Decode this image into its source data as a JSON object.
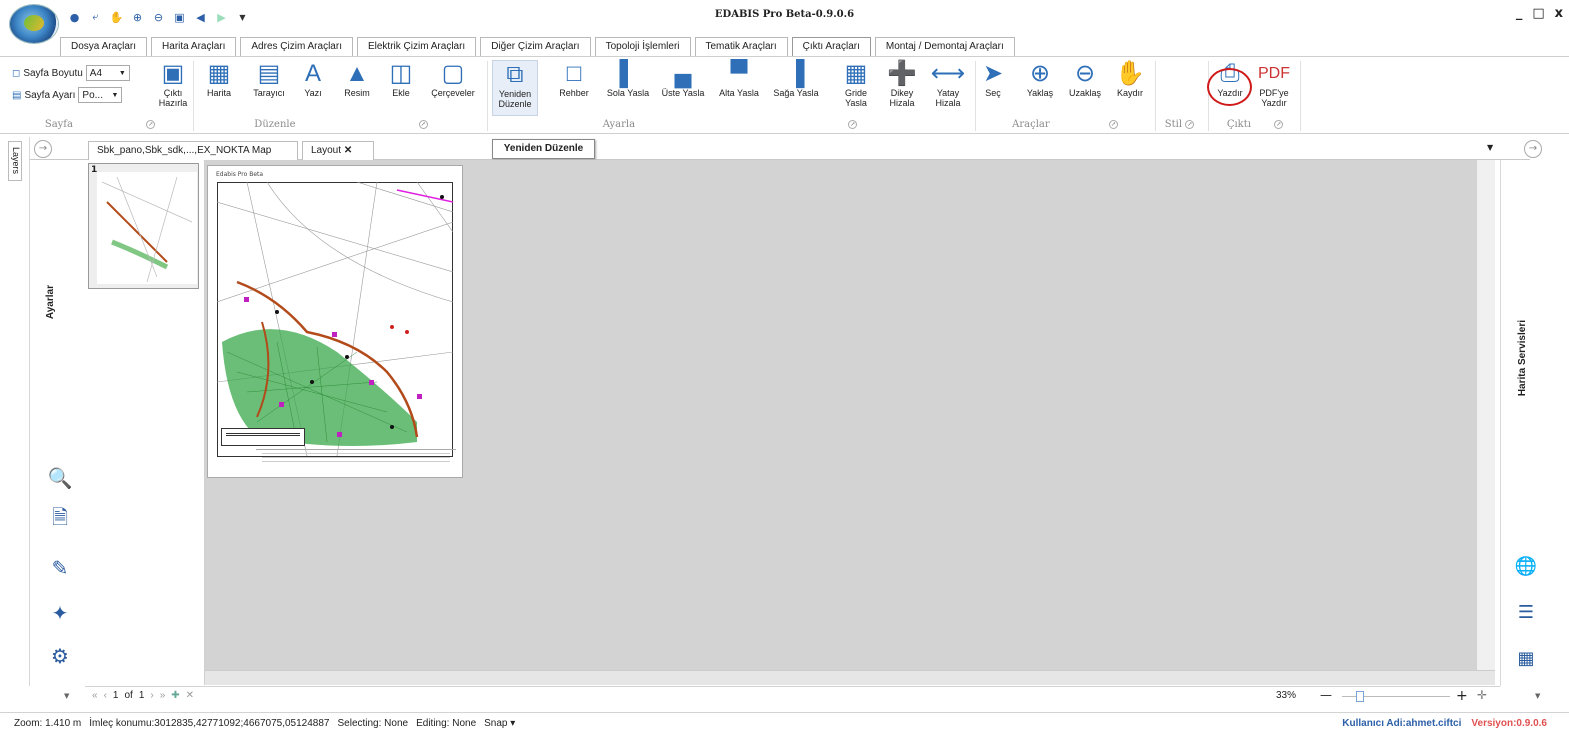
{
  "app": {
    "title": "EDABIS Pro Beta-0.9.0.6",
    "window_controls": [
      "_",
      "□",
      "x"
    ]
  },
  "tabs": [
    "Dosya Araçları",
    "Harita Araçları",
    "Adres Çizim Araçları",
    "Elektrik Çizim Araçları",
    "Diğer Çizim Araçları",
    "Topoloji İşlemleri",
    "Tematik Araçları",
    "Çıktı Araçları",
    "Montaj / Demontaj Araçları"
  ],
  "active_tab": "Çıktı Araçları",
  "ribbon": {
    "page_size_label": "Sayfa Boyutu",
    "page_size_value": "A4",
    "page_setup_label": "Sayfa Ayarı",
    "page_setup_value": "Po...",
    "cikti_hazirla": "Çıktı Hazırla",
    "buttons": {
      "harita": "Harita",
      "tarayici": "Tarayıcı",
      "yazi": "Yazı",
      "resim": "Resim",
      "ekle": "Ekle",
      "cerceveler": "Çerçeveler",
      "yeniden_duzenle": "Yeniden Düzenle",
      "rehber": "Rehber",
      "sola_yasla": "Sola Yasla",
      "uste_yasla": "Üste Yasla",
      "alta_yasla": "Alta Yasla",
      "saga_yasla": "Sağa Yasla",
      "gride_yasla": "Gride Yasla",
      "dikey_hizala": "Dikey Hizala",
      "yatay_hizala": "Yatay Hizala",
      "sec": "Seç",
      "yaklas": "Yaklaş",
      "uzaklas": "Uzaklaş",
      "kaydir": "Kaydır",
      "yazdir": "Yazdır",
      "pdfye_yazdir": "PDF'ye Yazdır"
    },
    "groups": {
      "sayfa": "Sayfa",
      "duzenle": "Düzenle",
      "ayarla": "Ayarla",
      "araclar": "Araçlar",
      "stil": "Stil",
      "cikti": "Çıktı"
    }
  },
  "doc_tabs": {
    "map_tab": "Sbk_pano,Sbk_sdk,...,EX_NOKTA Map",
    "layout_tab": "Layout"
  },
  "tooltip": "Yeniden Düzenle",
  "left_panel": {
    "layers_tab": "Layers",
    "settings_label": "Ayarlar"
  },
  "thumb_page_number": "1",
  "page_header": "Edabis Pro Beta",
  "navigation": {
    "page_current": "1",
    "of_label": "of",
    "page_total": "1"
  },
  "zoom": {
    "percent": "33%",
    "level": 0.33
  },
  "right_panel": {
    "label": "Harita Servisleri"
  },
  "status": {
    "zoom": "Zoom: 1.410 m",
    "cursor": "İmleç konumu:3012835,42771092;4667075,05124887",
    "selecting": "Selecting: None",
    "editing": "Editing: None",
    "snap": "Snap ▾",
    "user": "Kullanıcı Adi:ahmet.ciftci",
    "version": "Versiyon:0.9.0.6"
  },
  "colors": {
    "accent": "#2e6fb8",
    "highlight": "#d01818",
    "canvas": "#d3d3d3",
    "user_text": "#2c5fa8",
    "version_text": "#e05050"
  }
}
